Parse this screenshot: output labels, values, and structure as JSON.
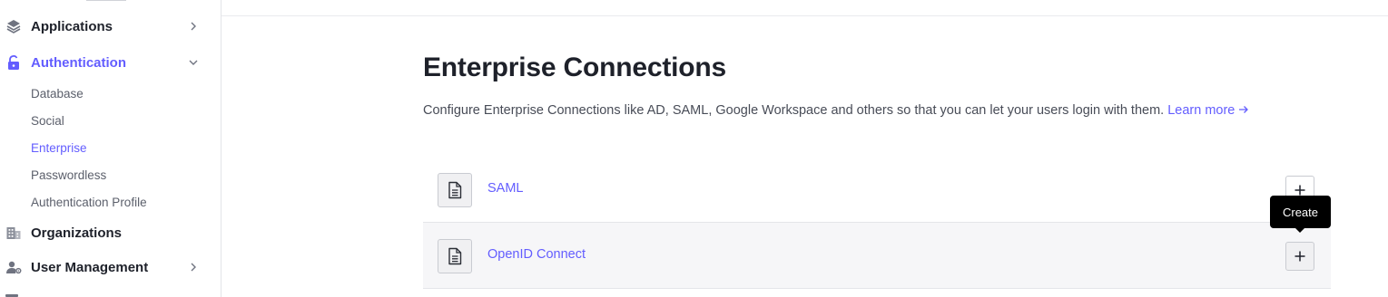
{
  "sidebar": {
    "items": [
      {
        "label": "Applications",
        "icon": "layers-icon"
      },
      {
        "label": "Authentication",
        "icon": "lock-icon"
      },
      {
        "label": "Organizations",
        "icon": "building-icon"
      },
      {
        "label": "User Management",
        "icon": "user-gear-icon"
      }
    ],
    "sub_items": [
      "Database",
      "Social",
      "Enterprise",
      "Passwordless",
      "Authentication Profile"
    ],
    "active_sub_item": "Enterprise"
  },
  "main": {
    "title": "Enterprise Connections",
    "description": "Configure Enterprise Connections like AD, SAML, Google Workspace and others so that you can let your users login with them.",
    "learn_more": "Learn more",
    "connections": [
      {
        "name": "SAML",
        "icon": "document-icon"
      },
      {
        "name": "OpenID Connect",
        "icon": "document-icon"
      }
    ],
    "tooltip": "Create"
  },
  "colors": {
    "accent": "#635dff",
    "text": "#1e212a",
    "muted": "#5b5f6b",
    "border": "#e3e4e8"
  }
}
